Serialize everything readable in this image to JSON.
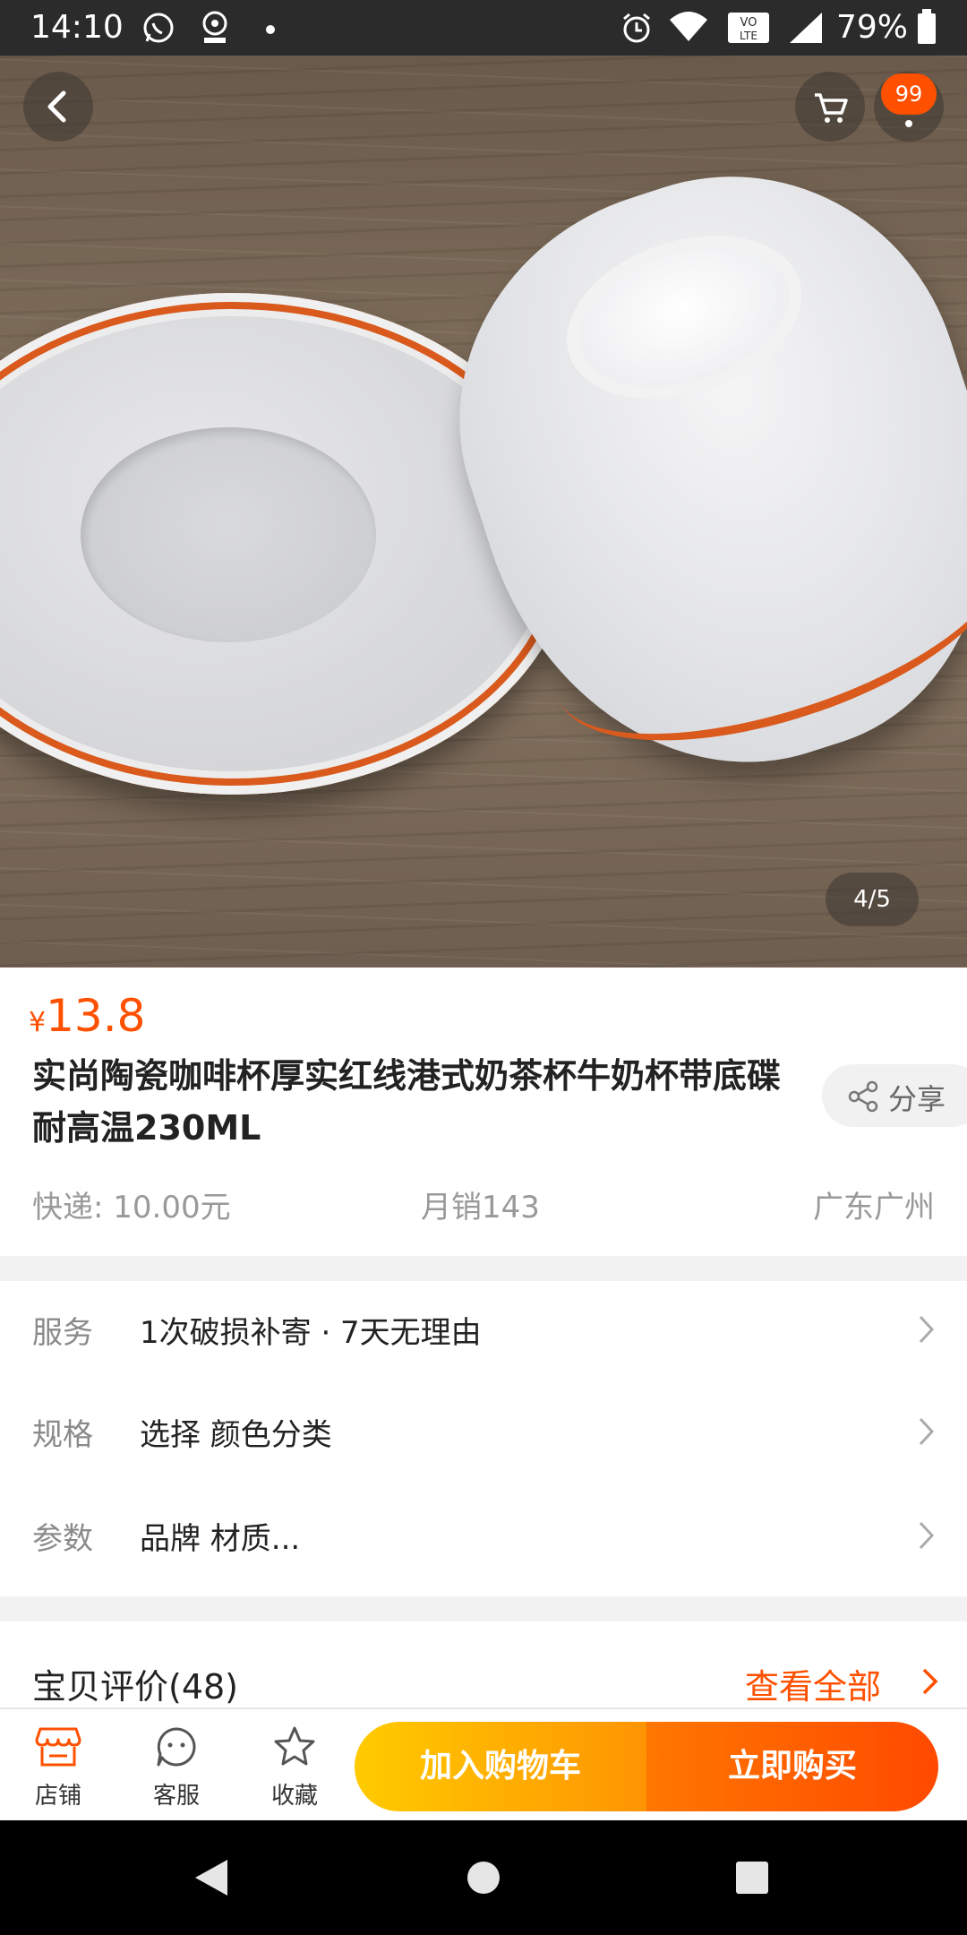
{
  "status_bar": {
    "time": "14:10",
    "battery": "79%",
    "icons": [
      "whatsapp-icon",
      "oncc-icon",
      "dot-icon",
      "alarm-icon",
      "wifi-icon",
      "volte-icon",
      "signal-icon",
      "battery-icon"
    ]
  },
  "gallery": {
    "cart_badge": "99",
    "pager": "4/5"
  },
  "product": {
    "currency": "¥",
    "price": "13.8",
    "title": "实尚陶瓷咖啡杯厚实红线港式奶茶杯牛奶杯带底碟耐高温230ML",
    "share_label": "分享",
    "shipping": "快递: 10.00元",
    "monthly_sales": "月销143",
    "location": "广东广州"
  },
  "service": {
    "rows": [
      {
        "key": "服务",
        "value": "1次破损补寄 · 7天无理由"
      },
      {
        "key": "规格",
        "value": "选择 颜色分类"
      },
      {
        "key": "参数",
        "value": "品牌 材质..."
      }
    ]
  },
  "reviews": {
    "title": "宝贝评价(48)",
    "view_all": "查看全部"
  },
  "action_bar": {
    "shop": "店铺",
    "service": "客服",
    "favorite": "收藏",
    "add_to_cart": "加入购物车",
    "buy_now": "立即购买"
  },
  "colors": {
    "accent": "#ff5000",
    "cart_gradient": [
      "#ffcb00",
      "#ff9402"
    ],
    "buy_gradient": [
      "#ff7700",
      "#ff4900"
    ]
  }
}
